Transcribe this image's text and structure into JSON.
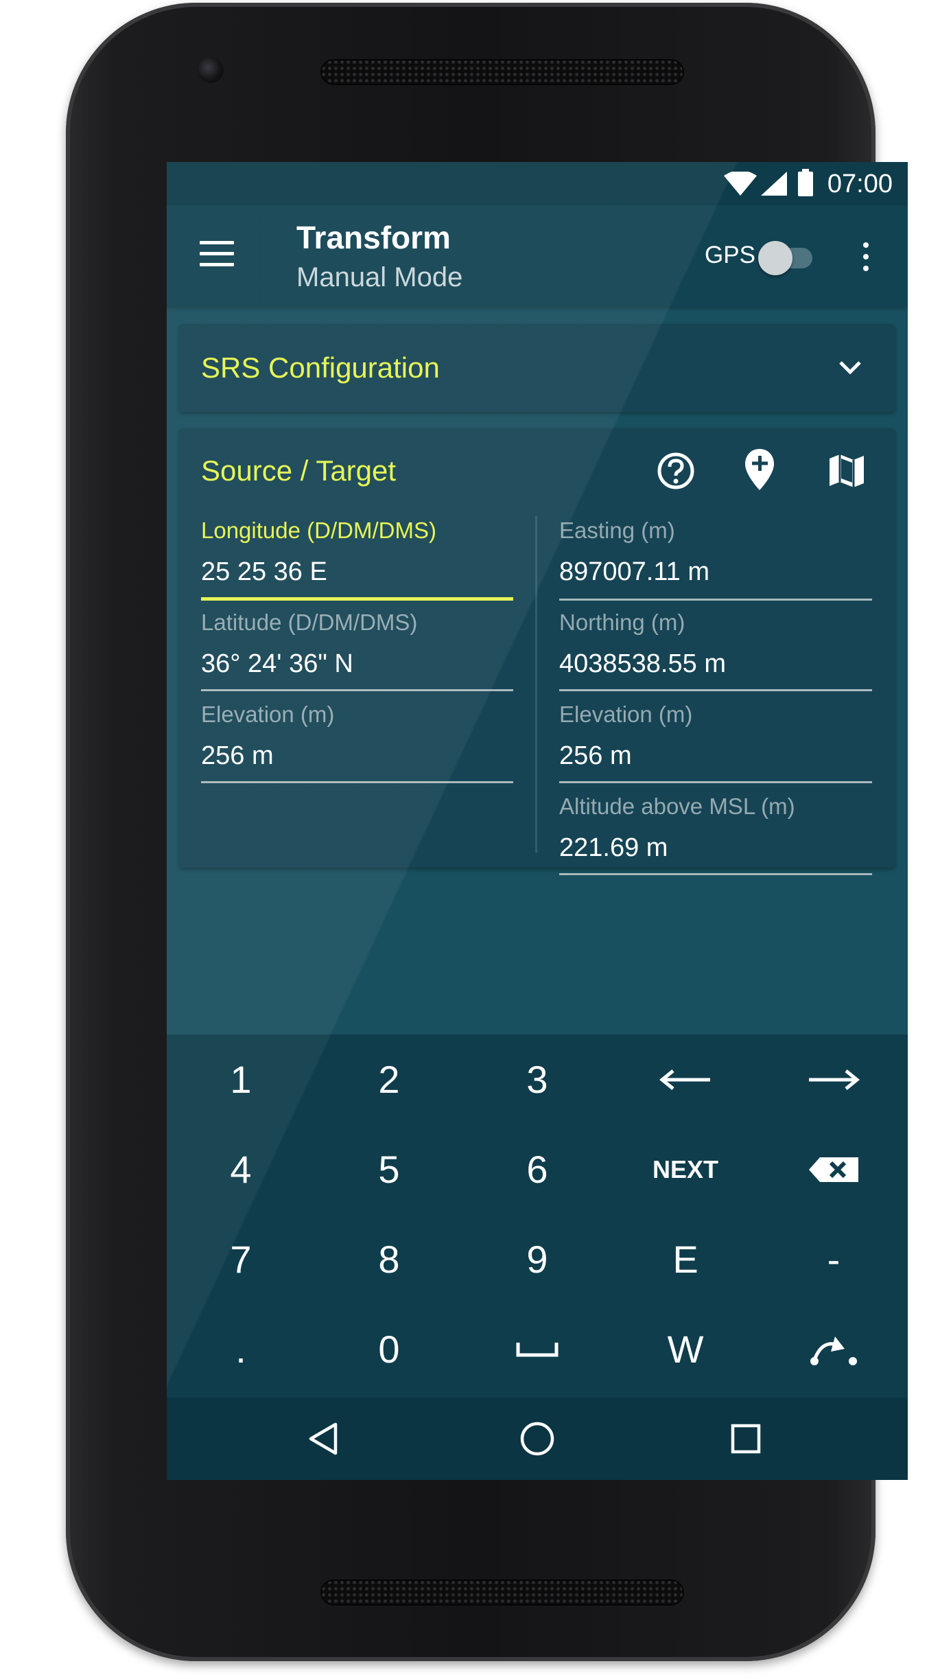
{
  "status_bar": {
    "time": "07:00",
    "icons": [
      "wifi-icon",
      "cell-signal-icon",
      "battery-icon"
    ]
  },
  "app_bar": {
    "title": "Transform",
    "subtitle": "Manual Mode",
    "gps_label": "GPS",
    "gps_enabled": false,
    "icons": [
      "menu-icon",
      "overflow-menu-icon"
    ]
  },
  "srs_card": {
    "title": "SRS Configuration",
    "expanded": false
  },
  "source_target_card": {
    "title": "Source / Target",
    "actions": [
      "help-icon",
      "add-location-icon",
      "map-icon"
    ],
    "source_fields": [
      {
        "label": "Longitude (D/DM/DMS)",
        "value": "25 25 36 E",
        "focused": true
      },
      {
        "label": "Latitude (D/DM/DMS)",
        "value": "36° 24' 36\" N",
        "focused": false
      },
      {
        "label": "Elevation (m)",
        "value": "256 m",
        "focused": false
      }
    ],
    "target_fields": [
      {
        "label": "Easting (m)",
        "value": "897007.11 m"
      },
      {
        "label": "Northing (m)",
        "value": "4038538.55 m"
      },
      {
        "label": "Elevation (m)",
        "value": "256 m"
      },
      {
        "label": "Altitude above MSL (m)",
        "value": "221.69 m"
      }
    ]
  },
  "keyboard": {
    "rows": [
      [
        "1",
        "2",
        "3",
        "←",
        "→"
      ],
      [
        "4",
        "5",
        "6",
        "NEXT",
        "backspace-icon"
      ],
      [
        "7",
        "8",
        "9",
        "E",
        "-"
      ],
      [
        ".",
        "0",
        "space-icon",
        "W",
        "redo-icon"
      ]
    ]
  },
  "nav_bar": {
    "icons": [
      "back-icon",
      "home-icon",
      "recents-icon"
    ]
  },
  "colors": {
    "accent": "#e6f54e",
    "screen_background": "#19505f",
    "card_background": "#164454",
    "app_bar": "#124352",
    "keyboard_background": "#0f3d4c"
  }
}
